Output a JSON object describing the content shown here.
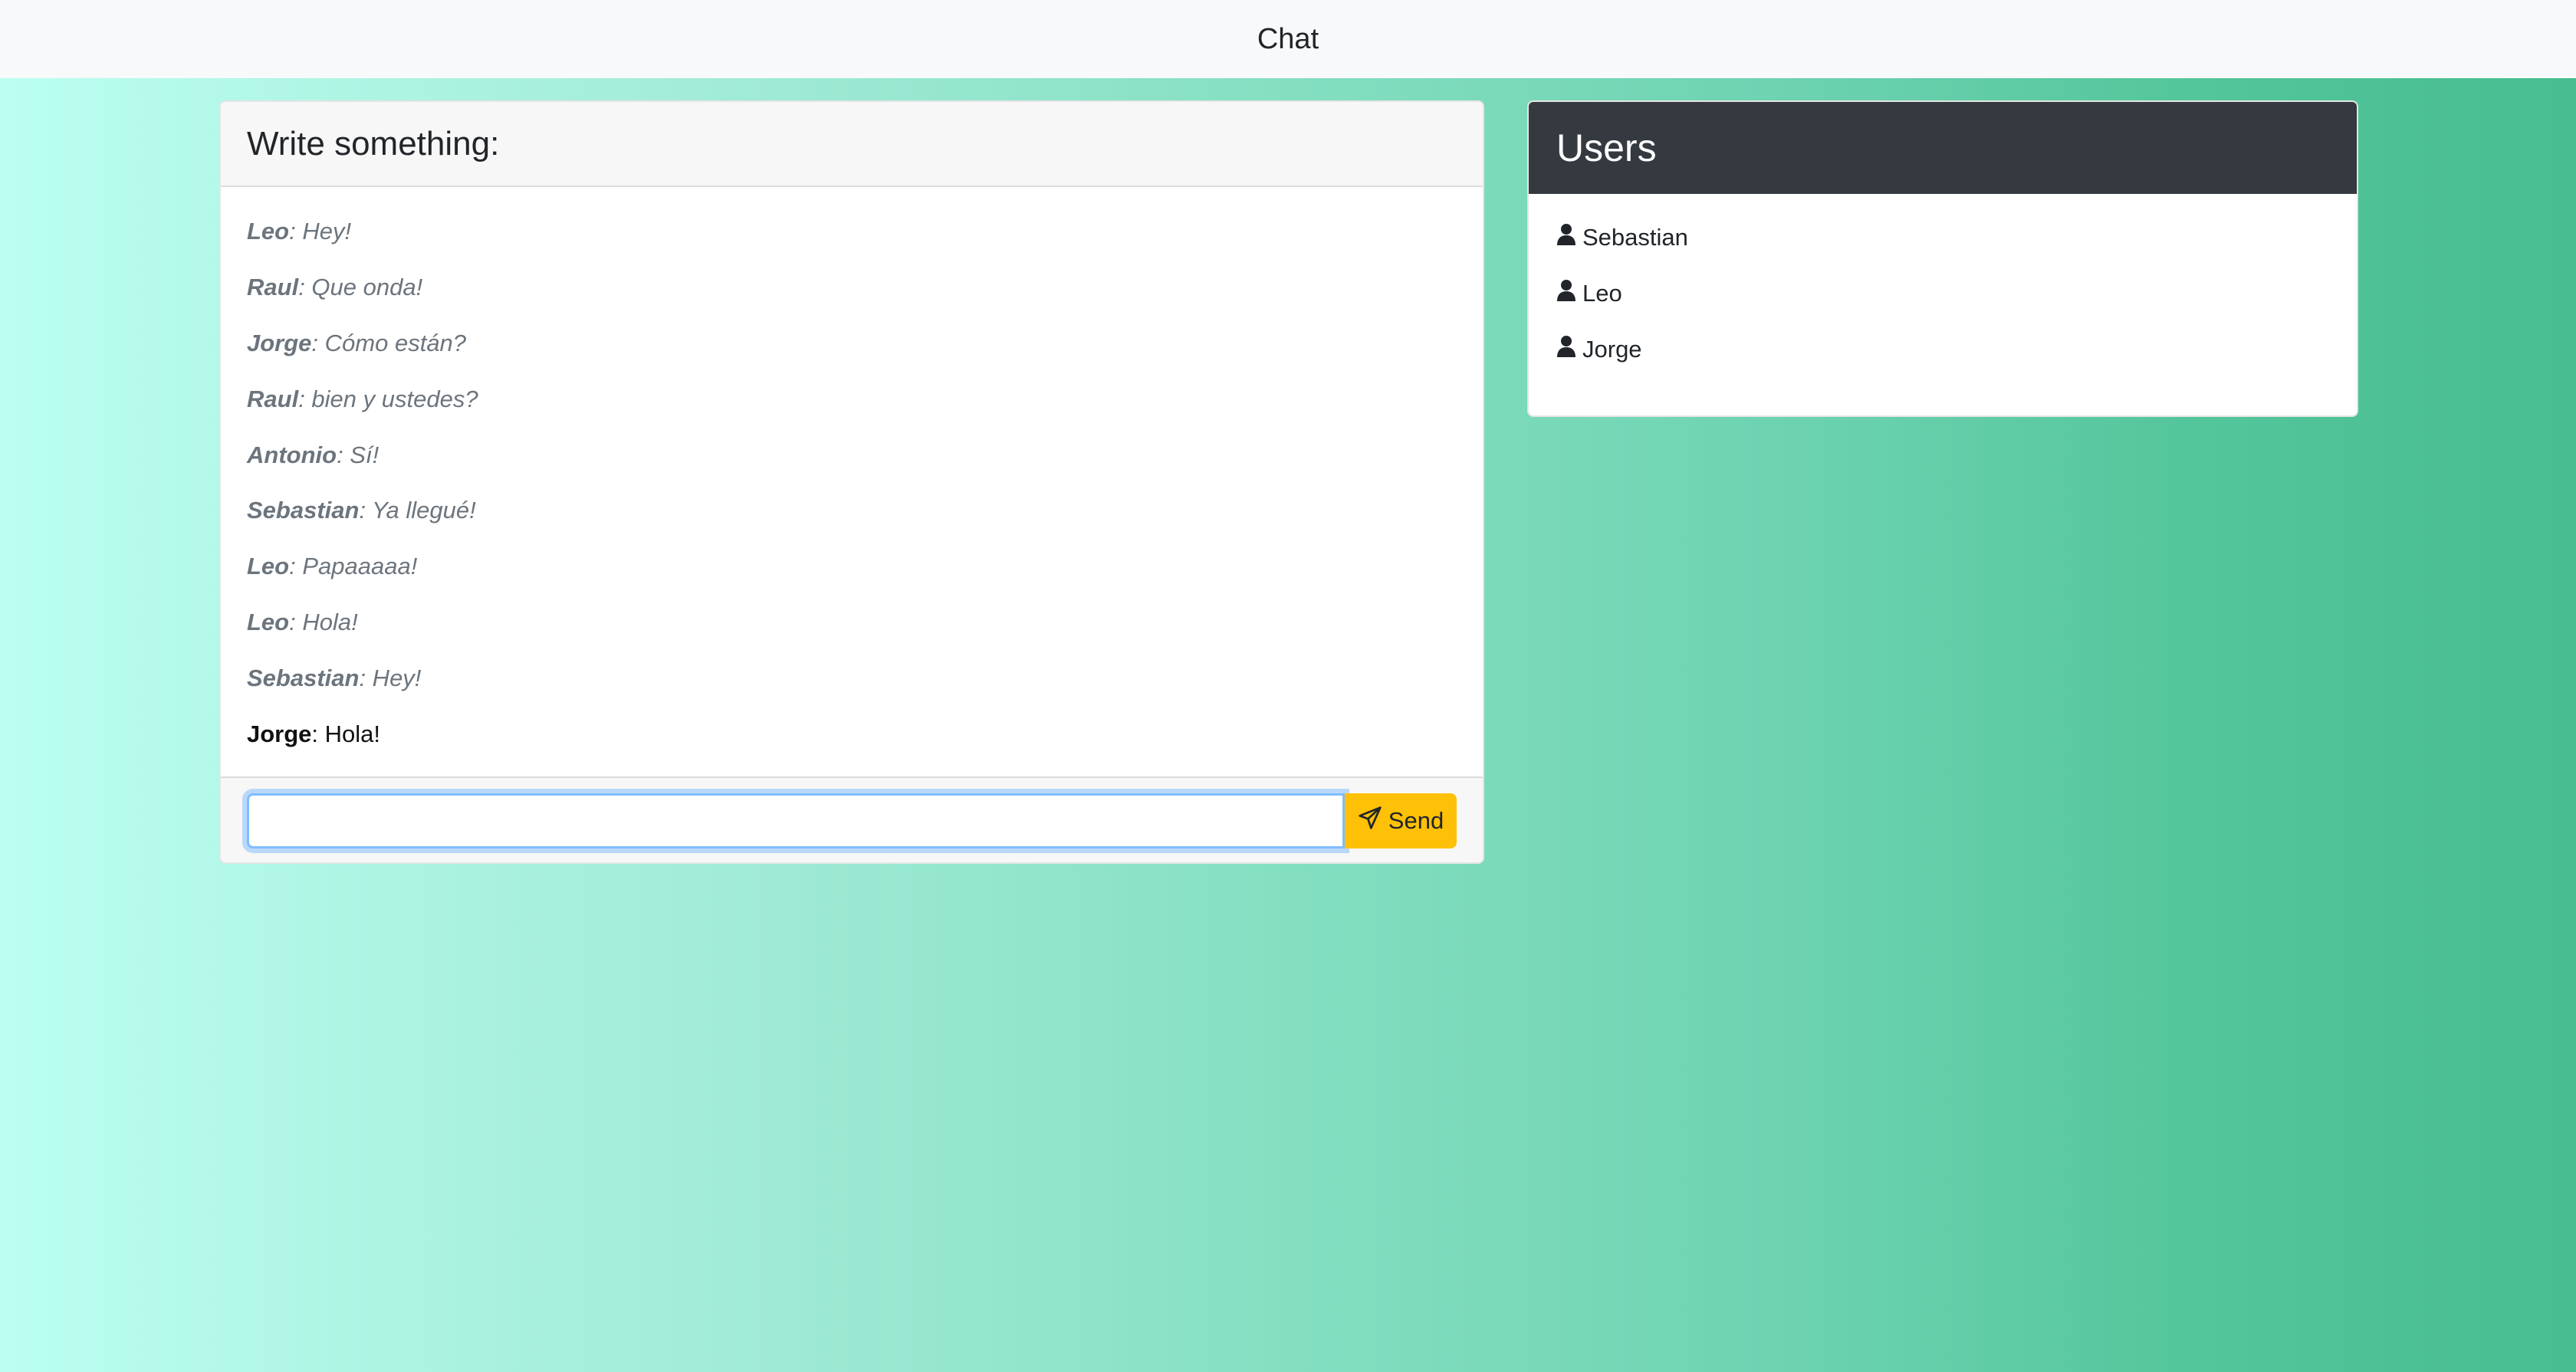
{
  "navbar": {
    "title": "Chat"
  },
  "chat": {
    "header_title": "Write something:",
    "messages": [
      {
        "user": "Leo",
        "text": ": Hey!"
      },
      {
        "user": "Raul",
        "text": ": Que onda!"
      },
      {
        "user": "Jorge",
        "text": ": Cómo están?"
      },
      {
        "user": "Raul",
        "text": ": bien y ustedes?"
      },
      {
        "user": "Antonio",
        "text": ": Sí!"
      },
      {
        "user": "Sebastian",
        "text": ": Ya llegué!"
      },
      {
        "user": "Leo",
        "text": ": Papaaaaa!"
      },
      {
        "user": "Leo",
        "text": ": Hola!"
      },
      {
        "user": "Sebastian",
        "text": ": Hey!"
      },
      {
        "user": "Jorge",
        "text": ": Hola!"
      }
    ],
    "input": {
      "value": "",
      "placeholder": ""
    },
    "send_label": "Send"
  },
  "users_panel": {
    "title": "Users",
    "users": [
      "Sebastian",
      "Leo",
      "Jorge"
    ]
  },
  "colors": {
    "send_button": "#ffc107",
    "users_header": "#343a40",
    "background_start": "#bafff1",
    "background_end": "#47bd90"
  },
  "icons": {
    "send": "paper-plane-icon",
    "user": "user-icon"
  }
}
